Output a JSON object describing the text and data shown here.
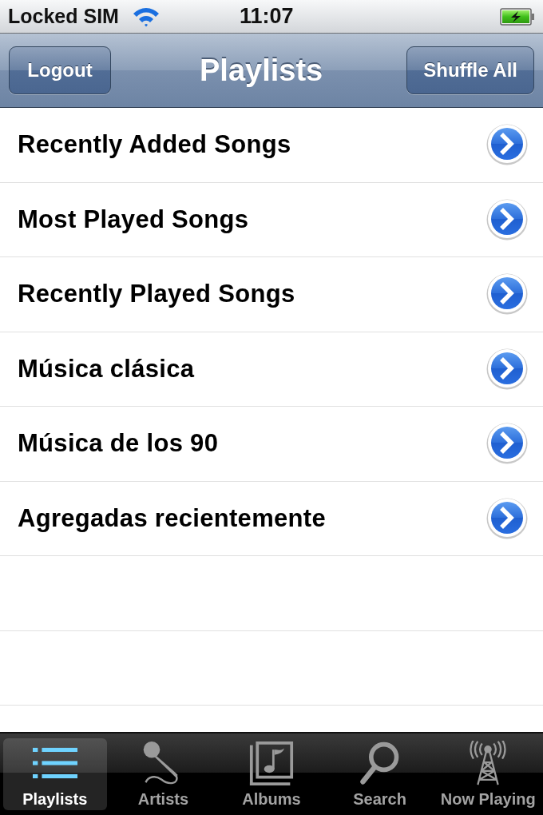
{
  "status_bar": {
    "carrier": "Locked SIM",
    "time": "11:07"
  },
  "nav_bar": {
    "left_button": "Logout",
    "title": "Playlists",
    "right_button": "Shuffle All"
  },
  "playlists": [
    {
      "name": "Recently Added Songs"
    },
    {
      "name": "Most Played Songs"
    },
    {
      "name": "Recently Played Songs"
    },
    {
      "name": "Música clásica"
    },
    {
      "name": "Música de los 90"
    },
    {
      "name": "Agregadas recientemente"
    }
  ],
  "tab_bar": [
    {
      "label": "Playlists",
      "kind": "playlists",
      "selected": true
    },
    {
      "label": "Artists",
      "kind": "artists",
      "selected": false
    },
    {
      "label": "Albums",
      "kind": "albums",
      "selected": false
    },
    {
      "label": "Search",
      "kind": "search",
      "selected": false
    },
    {
      "label": "Now Playing",
      "kind": "now_playing",
      "selected": false
    }
  ]
}
